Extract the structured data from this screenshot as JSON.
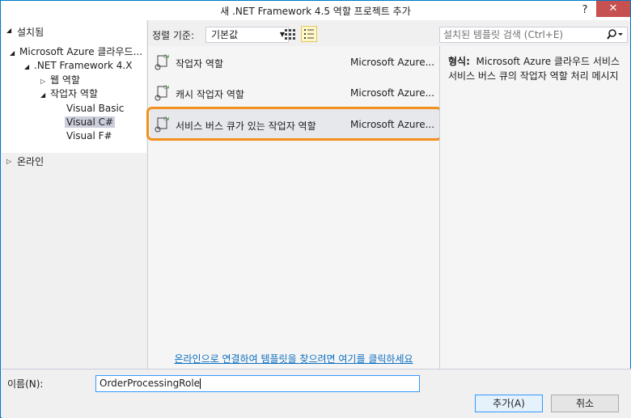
{
  "window": {
    "title": "새 .NET Framework 4.5 역할 프로젝트 추가",
    "help_label": "?",
    "close_label": "✕"
  },
  "left": {
    "installed_label": "설치됨",
    "tree": [
      {
        "label": "Microsoft Azure 클라우드...",
        "arrow": "◢",
        "level": 0
      },
      {
        "label": ".NET Framework 4.X",
        "arrow": "◢",
        "level": 1
      },
      {
        "label": "웹 역할",
        "arrow": "▷",
        "level": 2
      },
      {
        "label": "작업자 역할",
        "arrow": "◢",
        "level": 2
      },
      {
        "label": "Visual Basic",
        "arrow": "",
        "level": 3
      },
      {
        "label": "Visual C#",
        "arrow": "",
        "level": 3,
        "selected": true
      },
      {
        "label": "Visual F#",
        "arrow": "",
        "level": 3
      }
    ],
    "online_label": "온라인"
  },
  "toolbar": {
    "sort_label": "정렬 기준:",
    "sort_value": "기본값",
    "search_placeholder": "설치된 템플릿 검색 (Ctrl+E)"
  },
  "templates": [
    {
      "name": "작업자 역할",
      "type": "Microsoft Azure..."
    },
    {
      "name": "캐시 작업자 역할",
      "type": "Microsoft Azure..."
    },
    {
      "name": "서비스 버스 큐가 있는 작업자 역할",
      "type": "Microsoft Azure...",
      "selected": true
    }
  ],
  "online_link": "온라인으로 연결하여 템플릿을 찾으려면 여기를 클릭하세요",
  "details": {
    "type_label": "형식:",
    "type_value": "Microsoft Azure 클라우드 서비스",
    "description": "서비스 버스 큐의 작업자 역할 처리 메시지"
  },
  "bottom": {
    "name_label": "이름(N):",
    "name_value": "OrderProcessingRole",
    "add_button": "추가(A)",
    "cancel_button": "취소"
  },
  "colors": {
    "accent": "#007acc",
    "highlight": "#f3901d",
    "close": "#c75050",
    "link": "#0e70c0"
  }
}
